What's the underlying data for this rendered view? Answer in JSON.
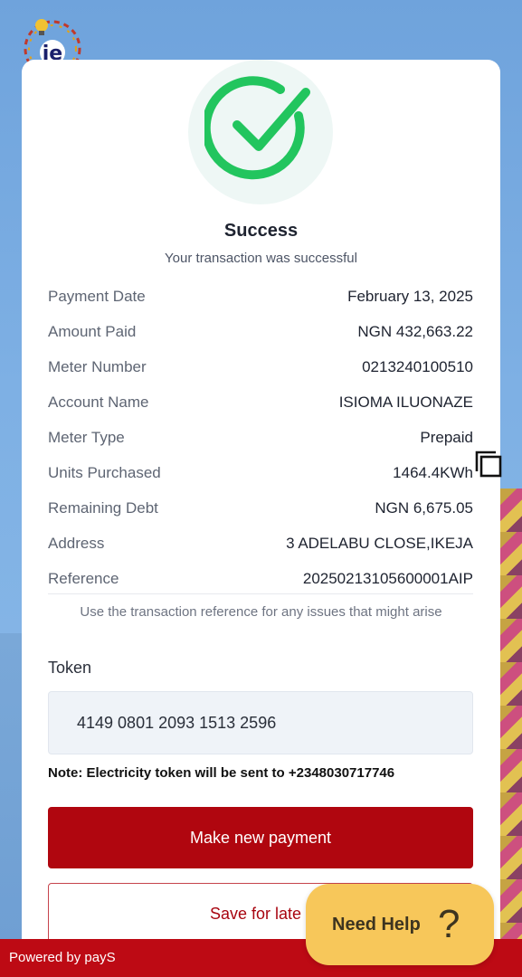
{
  "header": {
    "logo_text": "ie"
  },
  "status": {
    "title": "Success",
    "subtitle": "Your transaction was successful"
  },
  "details": [
    {
      "label": "Payment Date",
      "value": "February 13, 2025"
    },
    {
      "label": "Amount Paid",
      "value": "NGN 432,663.22"
    },
    {
      "label": "Meter Number",
      "value": "0213240100510"
    },
    {
      "label": "Account Name",
      "value": "ISIOMA ILUONAZE"
    },
    {
      "label": "Meter Type",
      "value": "Prepaid"
    },
    {
      "label": "Units Purchased",
      "value": "1464.4KWh"
    },
    {
      "label": "Remaining Debt",
      "value": "NGN 6,675.05"
    },
    {
      "label": "Address",
      "value": "3 ADELABU CLOSE,IKEJA"
    },
    {
      "label": "Reference",
      "value": "20250213105600001AIP"
    }
  ],
  "hint": "Use the transaction reference for any issues that might arise",
  "token": {
    "label": "Token",
    "value": "4149 0801 2093 1513 2596",
    "note": "Note: Electricity token will be sent to +2348030717746"
  },
  "actions": {
    "primary": "Make new payment",
    "secondary": "Save for late"
  },
  "help": {
    "label": "Need Help",
    "icon": "question-icon"
  },
  "footer": {
    "text": "Powered by payS"
  },
  "colors": {
    "primary": "#b0060f",
    "success": "#22c55e",
    "help": "#f7c75a"
  }
}
